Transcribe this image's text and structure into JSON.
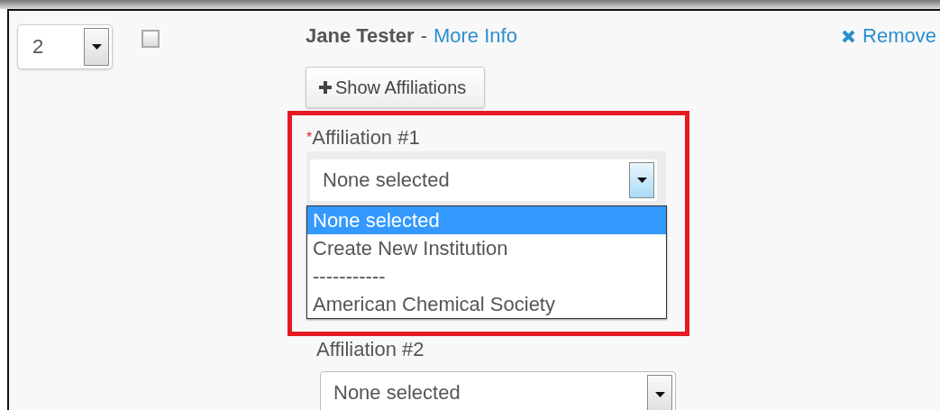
{
  "author": {
    "order": "2",
    "checked": false,
    "name": "Jane Tester",
    "separator": "-",
    "more_info": "More Info",
    "remove": "Remove"
  },
  "show_affiliations": "Show Affiliations",
  "highlight": true,
  "affiliations": [
    {
      "label": "Affiliation #1",
      "required": true,
      "required_mark": "*",
      "value": "None selected",
      "expanded": true,
      "options": [
        {
          "label": "None selected",
          "selected": true
        },
        {
          "label": "Create New Institution",
          "selected": false
        },
        {
          "label": "-----------",
          "selected": false
        },
        {
          "label": "American Chemical Society",
          "selected": false
        }
      ]
    },
    {
      "label": "Affiliation #2",
      "required": false,
      "value": "None selected",
      "expanded": false
    }
  ]
}
